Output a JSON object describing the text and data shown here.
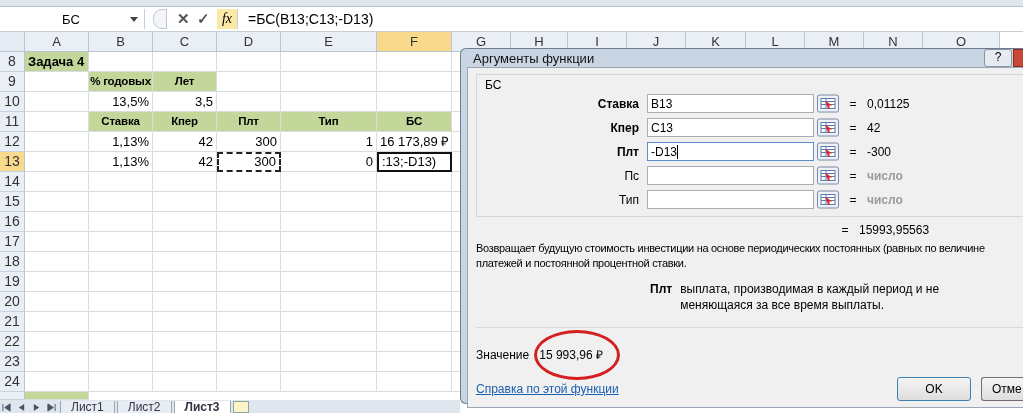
{
  "formula_bar": {
    "name_box": "БС",
    "cancel_symbol": "✕",
    "enter_symbol": "✓",
    "function_symbol": "fx",
    "formula": "=БС(B13;C13;-D13)"
  },
  "sheet": {
    "columns": [
      {
        "label": "A",
        "selected": false
      },
      {
        "label": "B",
        "selected": false
      },
      {
        "label": "C",
        "selected": false
      },
      {
        "label": "D",
        "selected": false
      },
      {
        "label": "E",
        "selected": false
      },
      {
        "label": "F",
        "selected": true
      },
      {
        "label": "G",
        "selected": false
      },
      {
        "label": "H",
        "selected": false
      },
      {
        "label": "I",
        "selected": false
      },
      {
        "label": "J",
        "selected": false
      },
      {
        "label": "K",
        "selected": false
      },
      {
        "label": "L",
        "selected": false
      },
      {
        "label": "M",
        "selected": false
      },
      {
        "label": "N",
        "selected": false
      },
      {
        "label": "O",
        "selected": false
      }
    ],
    "rows": [
      {
        "number": "8",
        "selected": false,
        "cells": [
          {
            "kind": "title",
            "text": "Задача 4"
          }
        ]
      },
      {
        "number": "9",
        "selected": false,
        "cells": [
          "",
          {
            "kind": "heading",
            "text": "% годовых"
          },
          {
            "kind": "heading",
            "text": "Лет"
          }
        ]
      },
      {
        "number": "10",
        "selected": false,
        "cells": [
          "",
          {
            "kind": "number",
            "text": "13,5%"
          },
          {
            "kind": "number",
            "text": "3,5"
          }
        ]
      },
      {
        "number": "11",
        "selected": false,
        "cells": [
          "",
          {
            "kind": "heading",
            "text": "Ставка"
          },
          {
            "kind": "heading",
            "text": "Кпер"
          },
          {
            "kind": "heading",
            "text": "Плт"
          },
          {
            "kind": "heading",
            "text": "Тип"
          },
          {
            "kind": "heading",
            "text": "БС"
          }
        ]
      },
      {
        "number": "12",
        "selected": false,
        "cells": [
          "",
          {
            "kind": "number",
            "text": "1,13%"
          },
          {
            "kind": "number",
            "text": "42"
          },
          {
            "kind": "number",
            "text": "300"
          },
          {
            "kind": "number",
            "text": "1"
          },
          {
            "kind": "number",
            "text": "16 173,89 ₽"
          }
        ]
      },
      {
        "number": "13",
        "selected": true,
        "cells": [
          "",
          {
            "kind": "number",
            "text": "1,13%"
          },
          {
            "kind": "number",
            "text": "42"
          },
          {
            "kind": "number",
            "text": "300",
            "marquee": true
          },
          {
            "kind": "number",
            "text": "0"
          },
          {
            "kind": "editing",
            "text": ":13;-D13)",
            "active": true
          }
        ]
      },
      {
        "number": "14",
        "selected": false,
        "cells": []
      },
      {
        "number": "15",
        "selected": false,
        "cells": []
      },
      {
        "number": "16",
        "selected": false,
        "cells": []
      },
      {
        "number": "17",
        "selected": false,
        "cells": []
      },
      {
        "number": "18",
        "selected": false,
        "cells": []
      },
      {
        "number": "19",
        "selected": false,
        "cells": []
      },
      {
        "number": "20",
        "selected": false,
        "cells": []
      },
      {
        "number": "21",
        "selected": false,
        "cells": []
      },
      {
        "number": "22",
        "selected": false,
        "cells": []
      },
      {
        "number": "23",
        "selected": false,
        "cells": []
      },
      {
        "number": "24",
        "selected": false,
        "cells": []
      }
    ]
  },
  "sheet_tabs": [
    {
      "label": "Лист1",
      "selected": false
    },
    {
      "label": "Лист2",
      "selected": false
    },
    {
      "label": "Лист3",
      "selected": true
    }
  ],
  "dialog": {
    "title": "Аргументы функции",
    "help_button": "?",
    "function_name": "БС",
    "arguments": [
      {
        "label": "Ставка",
        "required": true,
        "value": "B13",
        "relation": "=",
        "result": "0,01125",
        "focused": false
      },
      {
        "label": "Кпер",
        "required": true,
        "value": "C13",
        "relation": "=",
        "result": "42",
        "focused": false
      },
      {
        "label": "Плт",
        "required": true,
        "value": "-D13",
        "relation": "=",
        "result": "-300",
        "focused": true
      },
      {
        "label": "Пс",
        "required": false,
        "relation": "=",
        "result": "число",
        "focused": false
      },
      {
        "label": "Тип",
        "required": false,
        "relation": "=",
        "result": "число",
        "focused": false
      }
    ],
    "formula_result_relation": "=",
    "formula_result": "15993,95563",
    "description": "Возвращает будущую стоимость инвестиции на основе периодических постоянных (равных по величине",
    "description_line_2": "платежей и постоянной процентной ставки.",
    "argument_help_label": "Плт",
    "argument_help": "выплата, производимая в каждый период и не меняющаяся за все время выплаты.",
    "value_label": "Значение",
    "value": "15 993,96 ₽",
    "help_link": "Справка по этой функции",
    "ok_button": "OK",
    "cancel_button": "Отме"
  }
}
